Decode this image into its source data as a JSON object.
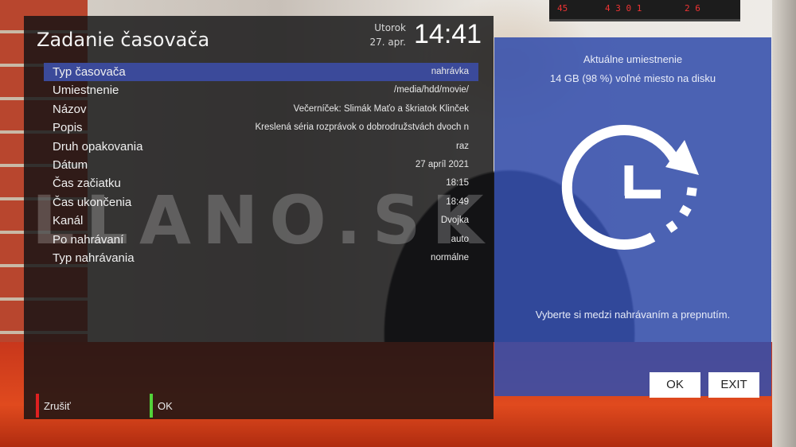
{
  "header": {
    "title": "Zadanie časovača",
    "day_name": "Utorok",
    "day_date": "27. apr.",
    "time": "14:41"
  },
  "fields": [
    {
      "label": "Typ časovača",
      "value": "nahrávka",
      "selected": true
    },
    {
      "label": "Umiestnenie",
      "value": "/media/hdd/movie/"
    },
    {
      "label": "Názov",
      "value": "Večerníček: Slimák Maťo a škriatok Klinček"
    },
    {
      "label": "Popis",
      "value": "Kreslená séria rozprávok o dobrodružstvách dvoch n"
    },
    {
      "label": "Druh opakovania",
      "value": "raz"
    },
    {
      "label": "Dátum",
      "value": "27 apríl 2021"
    },
    {
      "label": "Čas začiatku",
      "value": "18:15"
    },
    {
      "label": "Čas ukončenia",
      "value": "18:49"
    },
    {
      "label": "Kanál",
      "value": "Dvojka"
    },
    {
      "label": "Po nahrávaní",
      "value": "auto"
    },
    {
      "label": "Typ nahrávania",
      "value": "normálne"
    }
  ],
  "footer": {
    "red_label": "Zrušiť",
    "green_label": "OK",
    "red_color": "#e02020",
    "green_color": "#52d23a"
  },
  "info_panel": {
    "location_title": "Aktuálne umiestnenie",
    "free_space": "14 GB (98 %) voľné miesto na disku",
    "icon": "timer-clock-icon",
    "hint": "Vyberte si medzi nahrávaním a prepnutím.",
    "ok_button": "OK",
    "exit_button": "EXIT",
    "panel_color": "#344eac"
  },
  "watermark": "LLANO.SK"
}
